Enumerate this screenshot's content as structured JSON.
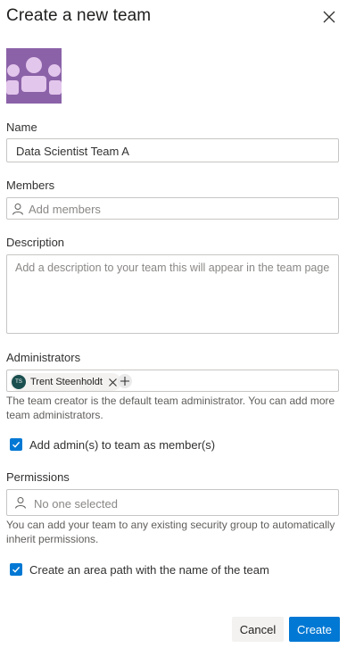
{
  "dialog": {
    "title": "Create a new team"
  },
  "form": {
    "name": {
      "label": "Name",
      "value": "Data Scientist Team A"
    },
    "members": {
      "label": "Members",
      "placeholder": "Add members"
    },
    "description": {
      "label": "Description",
      "placeholder": "Add a description to your team this will appear in the team page"
    },
    "administrators": {
      "label": "Administrators",
      "chips": [
        {
          "initials": "TS",
          "name": "Trent Steenholdt"
        }
      ],
      "help": "The team creator is the default team administrator. You can add more team administrators."
    },
    "add_admin_checkbox": {
      "label": "Add admin(s) to team as member(s)",
      "checked": true
    },
    "permissions": {
      "label": "Permissions",
      "placeholder": "No one selected",
      "help": "You can add your team to any existing security group to automatically inherit permissions."
    },
    "area_path_checkbox": {
      "label": "Create an area path with the name of the team",
      "checked": true
    }
  },
  "footer": {
    "cancel_label": "Cancel",
    "create_label": "Create"
  },
  "colors": {
    "accent": "#0078d4",
    "team_avatar_bg": "#8b62a8",
    "team_avatar_figures": "#e3c6ec",
    "chip_avatar": "#1b4f4f"
  },
  "icons": {
    "close": "close-icon",
    "team_avatar": "team-avatar-icon",
    "person": "person-icon",
    "remove": "remove-icon",
    "add": "add-icon",
    "checkmark": "checkmark-icon"
  }
}
